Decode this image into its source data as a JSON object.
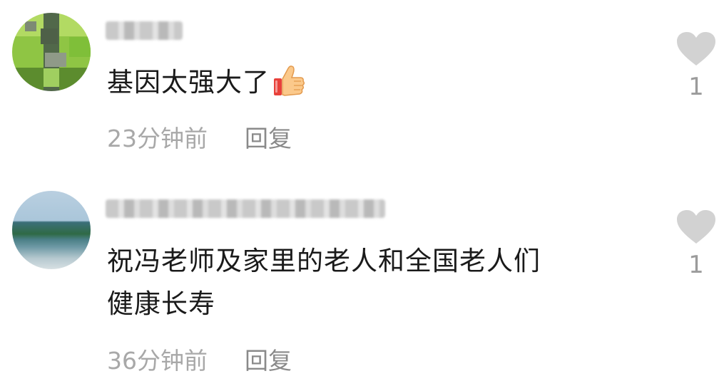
{
  "comments": [
    {
      "username": "",
      "text": "基因太强大了",
      "emoji": "thumbs-up-icon",
      "time": "23分钟前",
      "reply_label": "回复",
      "likes": "1"
    },
    {
      "username": "",
      "text_line1": "祝冯老师及家里的老人和全国老人们",
      "text_line2": "健康长寿",
      "time": "36分钟前",
      "reply_label": "回复",
      "likes": "1"
    }
  ],
  "colors": {
    "text": "#1a1a1a",
    "meta": "#a8a8a8",
    "heart": "#d2d2d2"
  }
}
